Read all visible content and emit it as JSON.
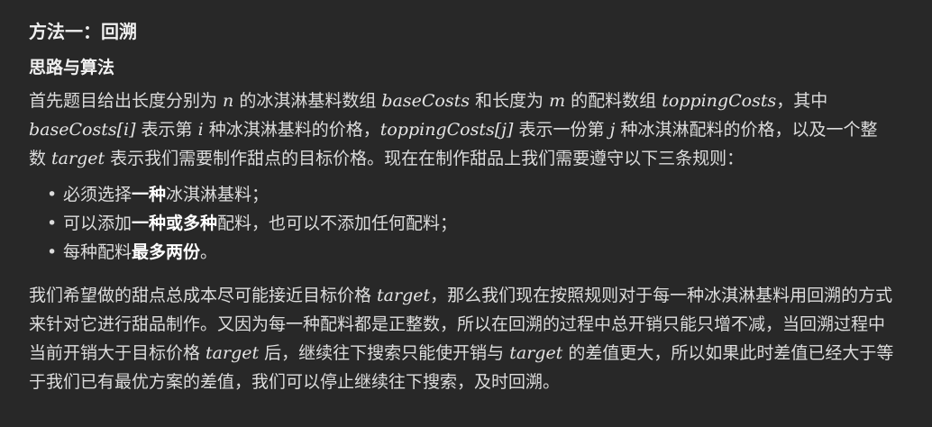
{
  "heading": "方法一：回溯",
  "subheading": "思路与算法",
  "intro": {
    "t1": "首先题目给出长度分别为 ",
    "m1": "n",
    "t2": " 的冰淇淋基料数组 ",
    "m2": "baseCosts",
    "t3": " 和长度为 ",
    "m3": "m",
    "t4": " 的配料数组 ",
    "m4": "toppingCosts",
    "t5": "，其中 ",
    "m5": "baseCosts[i]",
    "t6": " 表示第 ",
    "m6": "i",
    "t7": " 种冰淇淋基料的价格，",
    "m7": "toppingCosts[j]",
    "t8": " 表示一份第 ",
    "m8": "j",
    "t9": " 种冰淇淋配料的价格，以及一个整数 ",
    "m9": "target",
    "t10": " 表示我们需要制作甜点的目标价格。现在在制作甜品上我们需要遵守以下三条规则："
  },
  "rules": [
    {
      "before": "必须选择",
      "bold": "一种",
      "after": "冰淇淋基料；"
    },
    {
      "before": "可以添加",
      "bold": "一种或多种",
      "after": "配料，也可以不添加任何配料；"
    },
    {
      "before": "每种配料",
      "bold": "最多两份",
      "after": "。"
    }
  ],
  "bullet": "•",
  "conclusion": {
    "t1": "我们希望做的甜点总成本尽可能接近目标价格 ",
    "m1": "target",
    "t2": "，那么我们现在按照规则对于每一种冰淇淋基料用回溯的方式来针对它进行甜品制作。又因为每一种配料都是正整数，所以在回溯的过程中总开销只能只增不减，当回溯过程中当前开销大于目标价格 ",
    "m2": "target",
    "t3": " 后，继续往下搜索只能使开销与 ",
    "m3": "target",
    "t4": " 的差值更大，所以如果此时差值已经大于等于我们已有最优方案的差值，我们可以停止继续往下搜索，及时回溯。"
  }
}
